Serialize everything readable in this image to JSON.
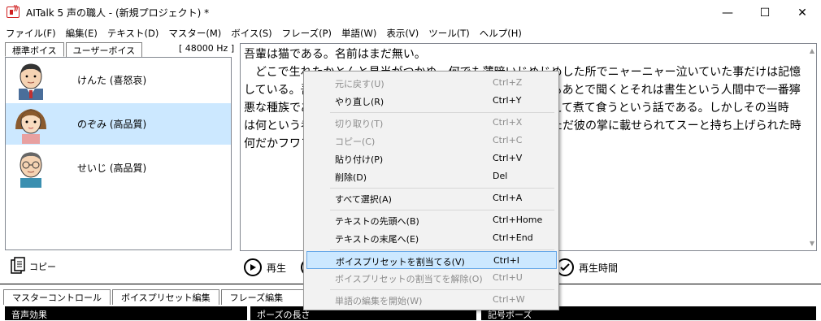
{
  "window": {
    "title": "AITalk 5 声の職人 - (新規プロジェクト) *",
    "minimize": "—",
    "maximize": "☐",
    "close": "✕"
  },
  "menu": [
    "ファイル(F)",
    "編集(E)",
    "テキスト(D)",
    "マスター(M)",
    "ボイス(S)",
    "フレーズ(P)",
    "単語(W)",
    "表示(V)",
    "ツール(T)",
    "ヘルプ(H)"
  ],
  "voice_panel": {
    "tabs": [
      "標準ボイス",
      "ユーザーボイス"
    ],
    "sample_rate": "[ 48000 Hz ]",
    "voices": [
      {
        "name": "けんた (喜怒哀)"
      },
      {
        "name": "のぞみ (高品質)"
      },
      {
        "name": "せいじ (高品質)"
      }
    ],
    "copy_label": "コピー"
  },
  "editor": {
    "text": "吾輩は猫である。名前はまだ無い。\n　どこで生れたかとんと見当がつかぬ。何でも薄暗いじめじめした所でニャーニャー泣いていた事だけは記憶\nしている。吾輩はここで始めて人間というものを見た。しかもあとで聞くとそれは書生という人間中で一番獰\n悪な種族であったそうだ。この書生というのは時々我々を捕えて煮て食うという話である。しかしその当時\nは何という考もなかったから別段恐しいとも思わなかった。ただ彼の掌に載せられてスーと持ち上げられた時\n何だかフワフワした感じがあったばかりである。"
  },
  "playback": {
    "play_label": "再生",
    "time_label": "再生時間"
  },
  "bottom_panel": {
    "tabs": [
      "マスターコントロール",
      "ボイスプリセット編集",
      "フレーズ編集"
    ],
    "strips": [
      "音声効果",
      "ポーズの長さ",
      "記号ポーズ"
    ]
  },
  "context_menu": {
    "items": [
      {
        "label": "元に戻す(U)",
        "shortcut": "Ctrl+Z",
        "enabled": false
      },
      {
        "label": "やり直し(R)",
        "shortcut": "Ctrl+Y",
        "enabled": true
      },
      {
        "label": "切り取り(T)",
        "shortcut": "Ctrl+X",
        "enabled": false
      },
      {
        "label": "コピー(C)",
        "shortcut": "Ctrl+C",
        "enabled": false
      },
      {
        "label": "貼り付け(P)",
        "shortcut": "Ctrl+V",
        "enabled": true
      },
      {
        "label": "削除(D)",
        "shortcut": "Del",
        "enabled": true
      },
      {
        "label": "すべて選択(A)",
        "shortcut": "Ctrl+A",
        "enabled": true
      },
      {
        "label": "テキストの先頭へ(B)",
        "shortcut": "Ctrl+Home",
        "enabled": true
      },
      {
        "label": "テキストの末尾へ(E)",
        "shortcut": "Ctrl+End",
        "enabled": true
      },
      {
        "label": "ボイスプリセットを割当てる(V)",
        "shortcut": "Ctrl+I",
        "enabled": true,
        "highlighted": true
      },
      {
        "label": "ボイスプリセットの割当てを解除(O)",
        "shortcut": "Ctrl+U",
        "enabled": false
      },
      {
        "label": "単語の編集を開始(W)",
        "shortcut": "Ctrl+W",
        "enabled": false
      }
    ]
  },
  "colors": {
    "selection": "#cce8ff",
    "highlight_border": "#66a7e8",
    "disabled_text": "#8c8c8c",
    "menu_bg": "#f2f2f2"
  }
}
